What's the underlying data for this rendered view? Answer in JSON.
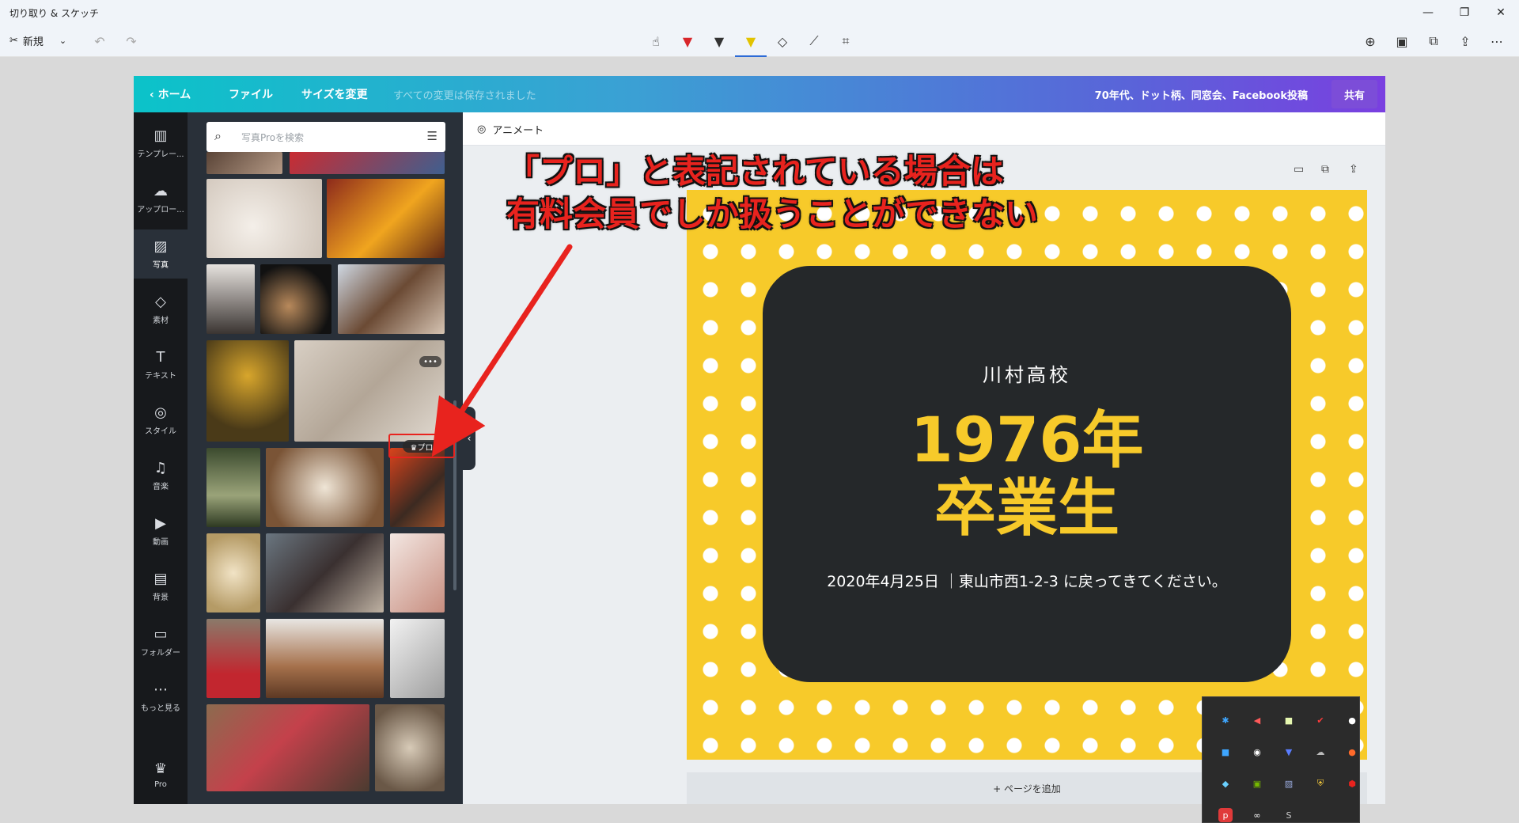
{
  "window": {
    "title": "切り取り & スケッチ",
    "new_label": "新規",
    "controls": {
      "minimize": "—",
      "restore": "❐",
      "close": "✕"
    }
  },
  "toolbar": {
    "tools": [
      "touch-writing-icon",
      "ballpoint-pen-icon",
      "pencil-icon",
      "highlighter-icon",
      "eraser-icon",
      "ruler-icon",
      "crop-icon"
    ],
    "right": [
      "zoom-icon",
      "save-icon",
      "copy-icon",
      "share-icon",
      "more-icon"
    ],
    "more_label": "⋯"
  },
  "canva": {
    "header": {
      "home": "ホーム",
      "file": "ファイル",
      "resize": "サイズを変更",
      "saved": "すべての変更は保存されました",
      "doc_name": "70年代、ドット柄、同窓会、Facebook投稿",
      "share": "共有"
    },
    "sidebar": [
      {
        "label": "テンプレー...",
        "icon": "template-icon"
      },
      {
        "label": "アップロー...",
        "icon": "upload-icon"
      },
      {
        "label": "写真",
        "icon": "photo-icon"
      },
      {
        "label": "素材",
        "icon": "elements-icon"
      },
      {
        "label": "テキスト",
        "icon": "text-icon"
      },
      {
        "label": "スタイル",
        "icon": "style-icon"
      },
      {
        "label": "音楽",
        "icon": "music-icon"
      },
      {
        "label": "動画",
        "icon": "video-icon"
      },
      {
        "label": "背景",
        "icon": "background-icon"
      },
      {
        "label": "フォルダー",
        "icon": "folder-icon"
      },
      {
        "label": "もっと見る",
        "icon": "more-icon"
      },
      {
        "label": "Pro",
        "icon": "crown-icon"
      }
    ],
    "search_placeholder": "写真Proを検索",
    "pro_badge": "♛プロ",
    "animate": "アニメート",
    "design": {
      "school": "川村高校",
      "main_line1": "1976年",
      "main_line2": "卒業生",
      "info": "2020年4月25日 ｜東山市西1-2-3 に戻ってきてください。"
    },
    "add_page": "+ ページを追加"
  },
  "annotation": {
    "line1": "「プロ」と表記されている場合は",
    "line2": "有料会員でしか扱うことができない"
  },
  "colors": {
    "accent_red": "#e8231e",
    "design_yellow": "#f7ca2a",
    "design_dark": "#25282a",
    "header_start": "#0bc3c9",
    "header_end": "#7a3fe0"
  }
}
